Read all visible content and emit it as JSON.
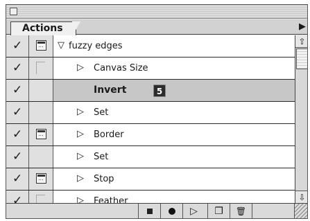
{
  "panel": {
    "tab_label": "Actions",
    "menu_arrow": "▶"
  },
  "actions": [
    {
      "check": "✓",
      "dialog": "box",
      "expander": "▽",
      "label": "fuzzy edges",
      "bold": false,
      "selected": false
    },
    {
      "check": "✓",
      "dialog": "ghost",
      "expander": "▷",
      "label": "Canvas Size",
      "bold": false,
      "selected": false
    },
    {
      "check": "✓",
      "dialog": "none",
      "expander": "",
      "label": "Invert",
      "bold": true,
      "selected": true,
      "badge": "5"
    },
    {
      "check": "✓",
      "dialog": "none",
      "expander": "▷",
      "label": "Set",
      "bold": false,
      "selected": false
    },
    {
      "check": "✓",
      "dialog": "box",
      "expander": "▷",
      "label": "Border",
      "bold": false,
      "selected": false
    },
    {
      "check": "✓",
      "dialog": "none",
      "expander": "▷",
      "label": "Set",
      "bold": false,
      "selected": false
    },
    {
      "check": "✓",
      "dialog": "box",
      "expander": "▷",
      "label": "Stop",
      "bold": false,
      "selected": false
    },
    {
      "check": "✓",
      "dialog": "ghost",
      "expander": "▷",
      "label": "Feather",
      "bold": false,
      "selected": false
    }
  ],
  "toolbar": {
    "buttons": [
      {
        "name": "stop-button",
        "icon": "stop-square-icon"
      },
      {
        "name": "record-button",
        "icon": "record-circle-icon"
      },
      {
        "name": "play-button",
        "icon": "play-triangle-icon",
        "glyph": "▷"
      },
      {
        "name": "new-set-button",
        "icon": "new-set-icon",
        "glyph": "❐"
      },
      {
        "name": "delete-button",
        "icon": "trash-icon",
        "glyph": "🗑"
      }
    ]
  },
  "scroll": {
    "up": "⇧",
    "down": "⇩"
  }
}
